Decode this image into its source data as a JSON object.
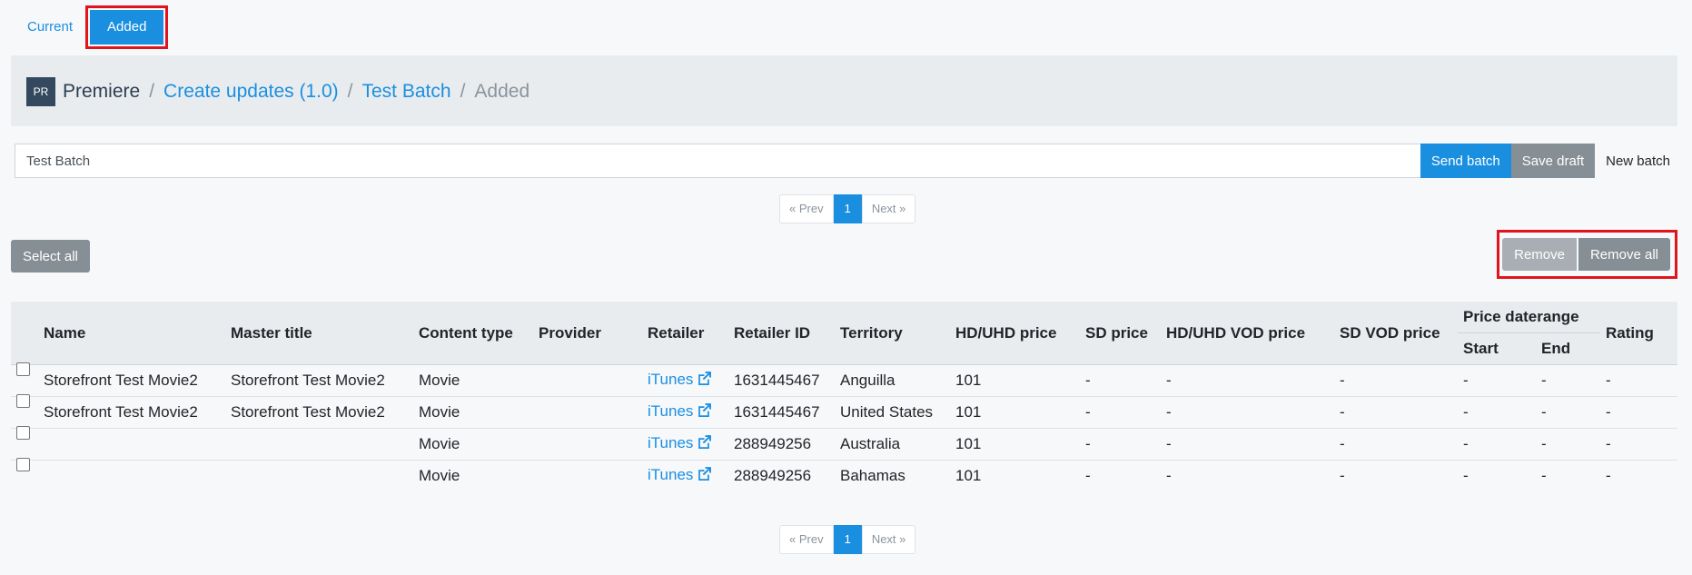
{
  "tabs": {
    "current": "Current",
    "added": "Added"
  },
  "breadcrumb": {
    "badge": "PR",
    "app": "Premiere",
    "create_updates": "Create updates (1.0)",
    "batch": "Test Batch",
    "current": "Added",
    "separator": "/"
  },
  "batch": {
    "name_value": "Test Batch",
    "send_label": "Send batch",
    "save_label": "Save draft",
    "new_label": "New batch"
  },
  "pagination": {
    "prev": "« Prev",
    "page": "1",
    "next": "Next »"
  },
  "actions": {
    "select_all": "Select all",
    "remove": "Remove",
    "remove_all": "Remove all"
  },
  "table": {
    "headers": {
      "name": "Name",
      "master_title": "Master title",
      "content_type": "Content type",
      "provider": "Provider",
      "retailer": "Retailer",
      "retailer_id": "Retailer ID",
      "territory": "Territory",
      "hd_price": "HD/UHD price",
      "sd_price": "SD price",
      "hd_vod_price": "HD/UHD VOD price",
      "sd_vod_price": "SD VOD price",
      "price_daterange": "Price daterange",
      "start": "Start",
      "end": "End",
      "rating": "Rating"
    },
    "rows": [
      {
        "name": "Storefront Test Movie2",
        "master_title": "Storefront Test Movie2",
        "content_type": "Movie",
        "provider": "",
        "retailer": "iTunes",
        "retailer_id": "1631445467",
        "territory": "Anguilla",
        "hd_price": "101",
        "sd_price": "-",
        "hd_vod_price": "-",
        "sd_vod_price": "-",
        "start": "-",
        "end": "-",
        "rating": "-"
      },
      {
        "name": "Storefront Test Movie2",
        "master_title": "Storefront Test Movie2",
        "content_type": "Movie",
        "provider": "",
        "retailer": "iTunes",
        "retailer_id": "1631445467",
        "territory": "United States",
        "hd_price": "101",
        "sd_price": "-",
        "hd_vod_price": "-",
        "sd_vod_price": "-",
        "start": "-",
        "end": "-",
        "rating": "-"
      },
      {
        "name": "",
        "master_title": "",
        "content_type": "Movie",
        "provider": "",
        "retailer": "iTunes",
        "retailer_id": "288949256",
        "territory": "Australia",
        "hd_price": "101",
        "sd_price": "-",
        "hd_vod_price": "-",
        "sd_vod_price": "-",
        "start": "-",
        "end": "-",
        "rating": "-"
      },
      {
        "name": "",
        "master_title": "",
        "content_type": "Movie",
        "provider": "",
        "retailer": "iTunes",
        "retailer_id": "288949256",
        "territory": "Bahamas",
        "hd_price": "101",
        "sd_price": "-",
        "hd_vod_price": "-",
        "sd_vod_price": "-",
        "start": "-",
        "end": "-",
        "rating": "-"
      }
    ]
  },
  "icons": {
    "external_link": "external-link-icon"
  },
  "colors": {
    "accent": "#1a8fe0",
    "highlight": "#e1141d",
    "secondary": "#868e96"
  }
}
